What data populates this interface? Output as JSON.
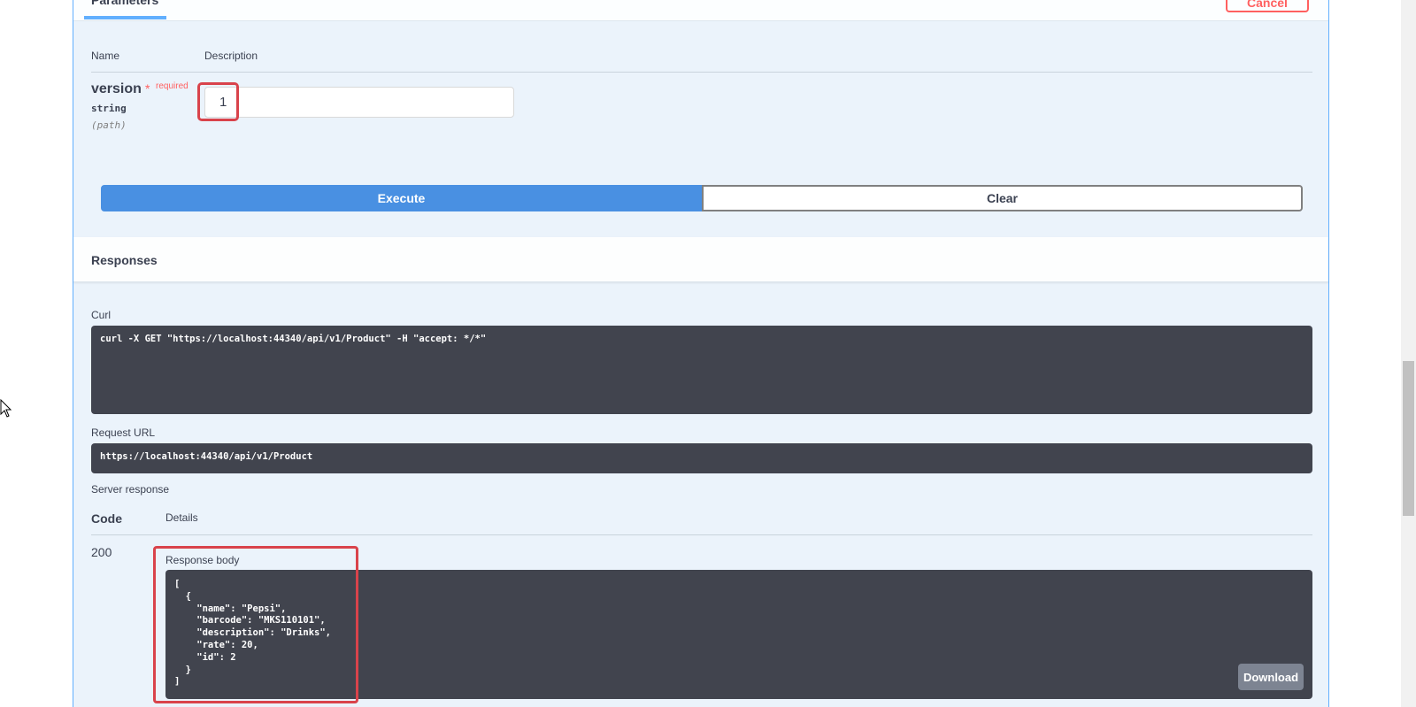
{
  "parameters": {
    "tab_label": "Parameters",
    "cancel_label": "Cancel",
    "col_name": "Name",
    "col_description": "Description",
    "param_name": "version",
    "required_star": "*",
    "required_text": "required",
    "param_type": "string",
    "param_in": "(path)",
    "param_value": "1"
  },
  "actions": {
    "execute_label": "Execute",
    "clear_label": "Clear"
  },
  "responses": {
    "title": "Responses",
    "curl_label": "Curl",
    "curl_command": "curl -X GET \"https://localhost:44340/api/v1/Product\" -H \"accept: */*\"",
    "request_url_label": "Request URL",
    "request_url": "https://localhost:44340/api/v1/Product",
    "server_response_label": "Server response",
    "code_header": "Code",
    "details_header": "Details",
    "status_code": "200",
    "response_body_label": "Response body",
    "response_body": "[\n  {\n    \"name\": \"Pepsi\",\n    \"barcode\": \"MKS110101\",\n    \"description\": \"Drinks\",\n    \"rate\": 20,\n    \"id\": 2\n  }\n]",
    "download_label": "Download"
  },
  "colors": {
    "accent_blue": "#61affe",
    "execute_blue": "#4990e2",
    "highlight_red": "#d9434b",
    "code_bg": "#41444e"
  },
  "icons": {
    "cursor": "mouse-pointer-icon"
  }
}
